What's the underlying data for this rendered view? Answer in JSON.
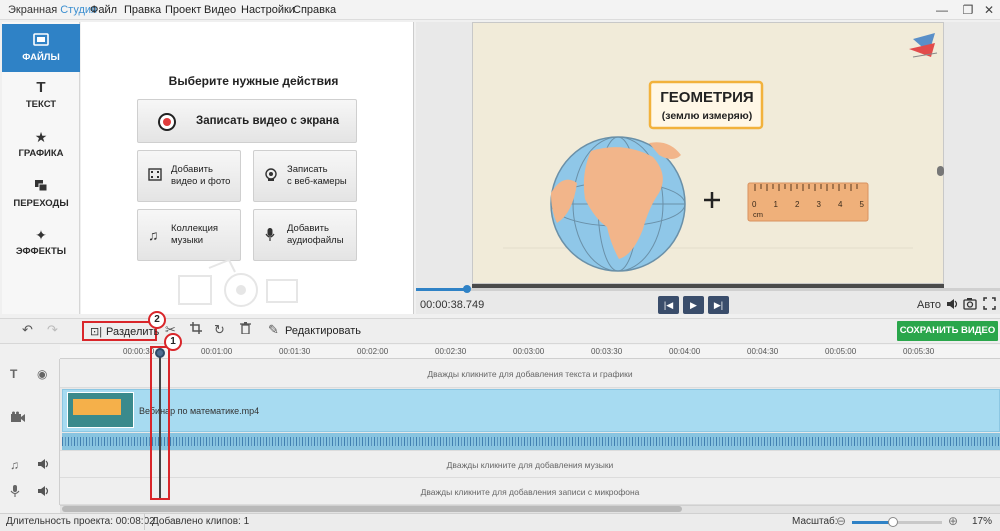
{
  "window": {
    "title_part1": "Экранная ",
    "title_part2": "Студия",
    "menu": [
      "Файл",
      "Правка",
      "Проект",
      "Видео",
      "Настройки",
      "Справка"
    ],
    "controls": [
      "—",
      "❐",
      "✕"
    ]
  },
  "sidebar": {
    "items": [
      {
        "label": "ФАЙЛЫ",
        "icon": "folder-icon",
        "active": true
      },
      {
        "label": "ТЕКСТ",
        "icon": "text-icon"
      },
      {
        "label": "ГРАФИКА",
        "icon": "star-icon"
      },
      {
        "label": "ПЕРЕХОДЫ",
        "icon": "transitions-icon"
      },
      {
        "label": "ЭФФЕКТЫ",
        "icon": "magic-wand-icon"
      }
    ]
  },
  "actions": {
    "title": "Выберите нужные действия",
    "record": "Записать видео с экрана",
    "add_video": "Добавить\nвидео и фото",
    "webcam": "Записать\nс веб-камеры",
    "music": "Коллекция\nмузыки",
    "audio": "Добавить\nаудиофайлы"
  },
  "preview": {
    "timecode": "00:00:38.749",
    "auto_label": "Авто",
    "progress_fraction": 0.013
  },
  "toolbar": {
    "split_label": "Разделить",
    "edit_label": "Редактировать",
    "save_label": "СОХРАНИТЬ ВИДЕО"
  },
  "ruler": {
    "ticks": [
      "00:00:30",
      "00:01:00",
      "00:01:30",
      "00:02:00",
      "00:02:30",
      "00:03:00",
      "00:03:30",
      "00:04:00",
      "00:04:30",
      "00:05:00",
      "00:05:30"
    ]
  },
  "timeline": {
    "text_hint": "Дважды кликните для добавления текста и графики",
    "video_name": "Вебинар по математике.mp4",
    "music_hint": "Дважды кликните для добавления музыки",
    "mic_hint": "Дважды кликните для добавления записи с микрофона",
    "markers": [
      "1",
      "2"
    ]
  },
  "status": {
    "duration": "Длительность проекта: 00:08:02",
    "clips": "Добавлено клипов: 1",
    "zoom_label": "Масштаб:",
    "zoom_value": "17%"
  },
  "slide": {
    "title": "ГЕОМЕТРИЯ",
    "subtitle": "(землю измеряю)",
    "ruler_numbers": [
      "0",
      "1",
      "2",
      "3",
      "4",
      "5"
    ],
    "ruler_unit": "cm",
    "plus": "+"
  },
  "colors": {
    "accent": "#2f82c6",
    "save_green": "#2aa64b",
    "highlight_red": "#d9262a",
    "video_track": "#a7dbf1"
  }
}
